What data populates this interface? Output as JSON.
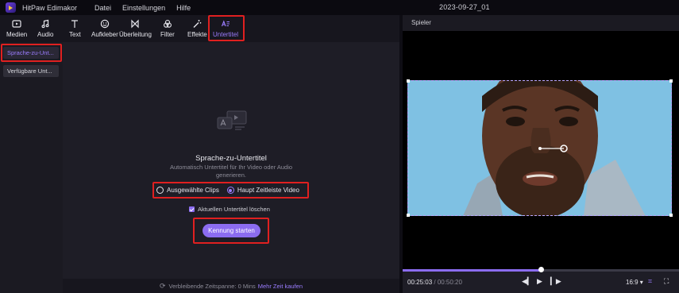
{
  "titlebar": {
    "app_name": "HitPaw Edimakor",
    "menu": [
      "Datei",
      "Einstellungen",
      "Hilfe"
    ],
    "doc_title": "2023-09-27_01"
  },
  "toolbar": {
    "items": [
      {
        "label": "Medien",
        "icon": "media-icon"
      },
      {
        "label": "Audio",
        "icon": "music-note-icon"
      },
      {
        "label": "Text",
        "icon": "text-icon"
      },
      {
        "label": "Aufkleber",
        "icon": "sticker-icon"
      },
      {
        "label": "Überleitung",
        "icon": "transition-icon"
      },
      {
        "label": "Filter",
        "icon": "filter-icon"
      },
      {
        "label": "Effekte",
        "icon": "magic-wand-icon"
      },
      {
        "label": "Untertitel",
        "icon": "subtitle-icon",
        "active": true
      }
    ]
  },
  "sidebar": {
    "items": [
      {
        "label": "Sprache-zu-Untertitel",
        "display": "Sprache-zu-Unt...",
        "active": true
      },
      {
        "label": "Verfügbare Untertitel",
        "display": "Verfügbare Unt...",
        "active": false
      }
    ]
  },
  "main": {
    "heading": "Sprache-zu-Untertitel",
    "description": "Automatisch Untertitel für Ihr Video oder Audio generieren.",
    "radio_options": [
      {
        "label": "Ausgewählte Clips",
        "selected": false
      },
      {
        "label": "Haupt Zeitleiste Video",
        "selected": true
      }
    ],
    "checkbox_label": "Aktuellen Untertitel löschen",
    "checkbox_checked": true,
    "start_button": "Kennung starten",
    "footer_text": "Verbleibende Zeitspanne: 0 Mins",
    "footer_link": "Mehr Zeit kaufen"
  },
  "player": {
    "header": "Spieler",
    "current_time": "00:25:03",
    "separator": " / ",
    "total_time": "00:50:20",
    "progress": 0.5,
    "aspect_ratio": "16:9",
    "accent": "#8b6cf0"
  }
}
